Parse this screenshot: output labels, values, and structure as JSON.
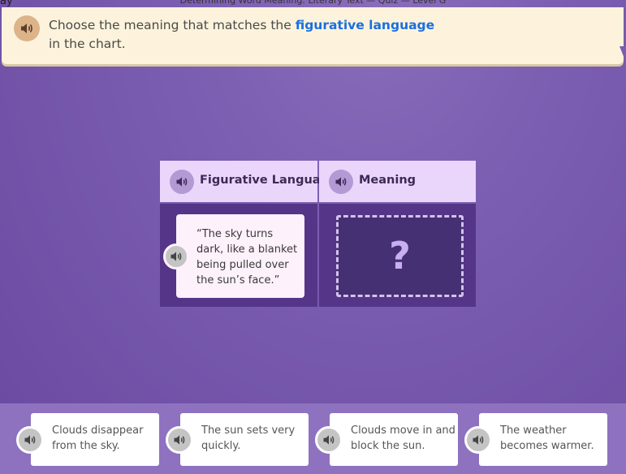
{
  "window": {
    "title": "Determining Word Meaning: Literary Text — Quiz — Level G",
    "left_fragment": "ay"
  },
  "instructions": {
    "text_before": "Choose the meaning that matches the ",
    "highlight": "figurative language",
    "text_after": " in the chart."
  },
  "chart": {
    "headers": [
      "Figurative Language",
      "Meaning"
    ],
    "quote": "“The sky turns dark, like a blanket being pulled over the sun’s face.”",
    "dropzone_mark": "?"
  },
  "options": [
    "Clouds disappear from the sky.",
    "The sun sets very quickly.",
    "Clouds move in and block the sun.",
    "The weather becomes warmer."
  ],
  "colors": {
    "highlight": "#1b6fe0",
    "instruction_bg": "#fdf3dc",
    "header_bg": "#ead6fb",
    "cell_bg": "#553588",
    "tray_bg": "#8e72c0"
  },
  "icons": {
    "speaker": "speaker-icon",
    "dropzone": "question-mark"
  }
}
